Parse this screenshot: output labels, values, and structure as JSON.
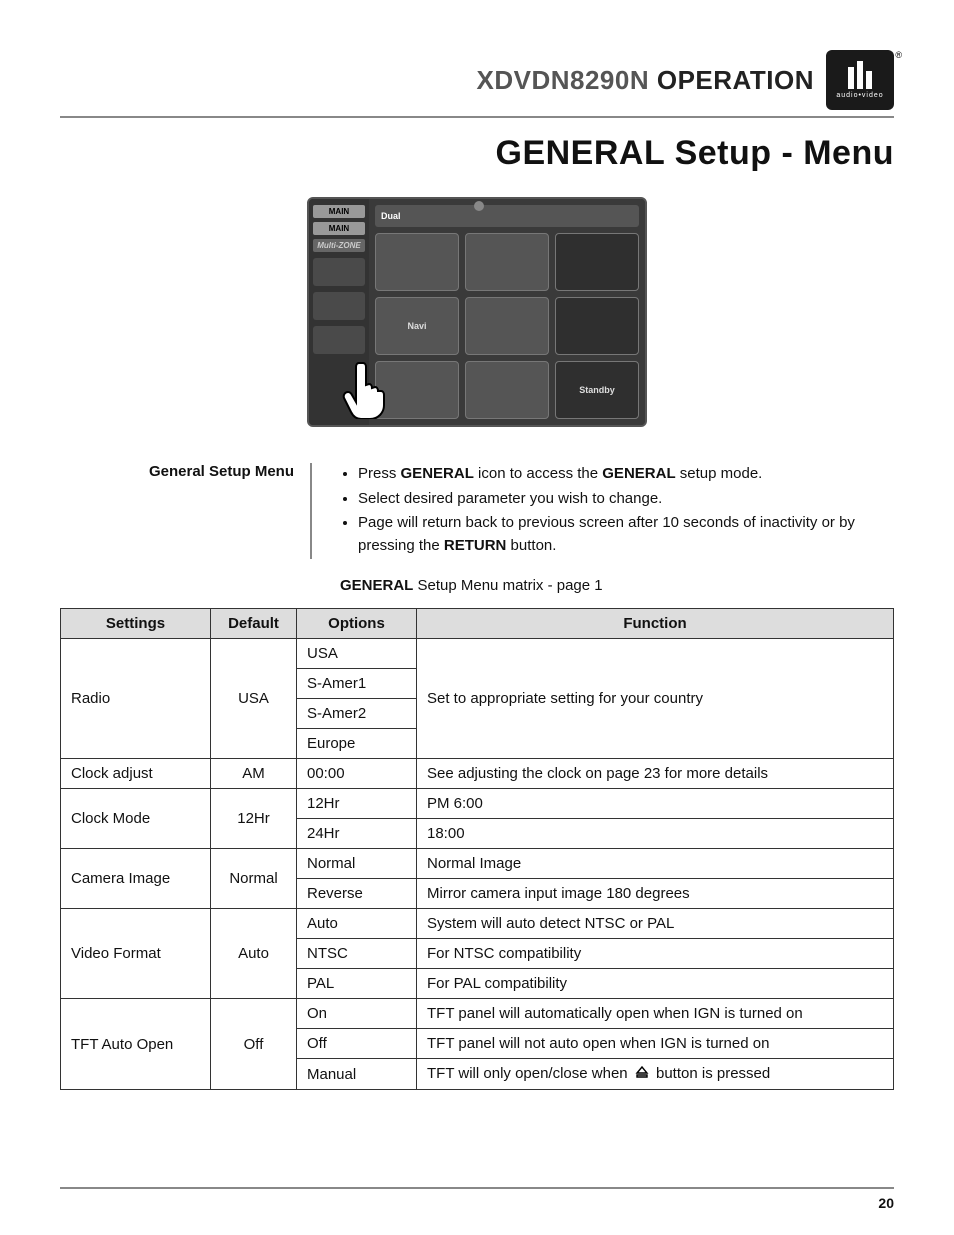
{
  "header": {
    "model": "XDVDN8290N",
    "word": "OPERATION",
    "logo_sub": "audio•video"
  },
  "page_title": "GENERAL Setup - Menu",
  "device": {
    "tab_main": "MAIN",
    "tab_main2": "MAIN",
    "tab_multi": "Multi-ZONE",
    "brand": "Dual",
    "cell_navi": "Navi",
    "cell_standby": "Standby"
  },
  "section": {
    "label": "General Setup Menu",
    "bullets": [
      {
        "pre": "Press ",
        "b1": "GENERAL",
        "mid": " icon to access the ",
        "b2": "GENERAL",
        "post": " setup mode."
      },
      {
        "text": "Select desired parameter you wish to change."
      },
      {
        "pre": "Page will return back to previous screen after 10 seconds of inactivity or by pressing the ",
        "b1": "RETURN",
        "post": " button."
      }
    ],
    "caption_b": "GENERAL",
    "caption_rest": " Setup Menu matrix - page 1"
  },
  "table": {
    "headers": {
      "settings": "Settings",
      "default": "Default",
      "options": "Options",
      "function": "Function"
    },
    "rows": {
      "radio": {
        "setting": "Radio",
        "default": "USA",
        "opts": [
          "USA",
          "S-Amer1",
          "S-Amer2",
          "Europe"
        ],
        "func": "Set to appropriate setting for your country"
      },
      "clock_adjust": {
        "setting": "Clock adjust",
        "default": "AM",
        "opt": "00:00",
        "func": "See adjusting the clock on page 23 for more details"
      },
      "clock_mode": {
        "setting": "Clock Mode",
        "default": "12Hr",
        "opts": [
          "12Hr",
          "24Hr"
        ],
        "funcs": [
          "PM 6:00",
          "18:00"
        ]
      },
      "camera": {
        "setting": "Camera Image",
        "default": "Normal",
        "opts": [
          "Normal",
          "Reverse"
        ],
        "funcs": [
          "Normal Image",
          "Mirror camera input image 180 degrees"
        ]
      },
      "video": {
        "setting": "Video Format",
        "default": "Auto",
        "opts": [
          "Auto",
          "NTSC",
          "PAL"
        ],
        "funcs": [
          "System will auto detect NTSC or PAL",
          "For NTSC compatibility",
          "For PAL compatibility"
        ]
      },
      "tft": {
        "setting": "TFT Auto Open",
        "default": "Off",
        "opts": [
          "On",
          "Off",
          "Manual"
        ],
        "funcs": [
          "TFT panel will automatically open when IGN is turned on",
          "TFT panel will not auto open when IGN is turned on"
        ],
        "func3_pre": "TFT will only open/close when ",
        "func3_post": " button is pressed"
      }
    }
  },
  "page_number": "20"
}
